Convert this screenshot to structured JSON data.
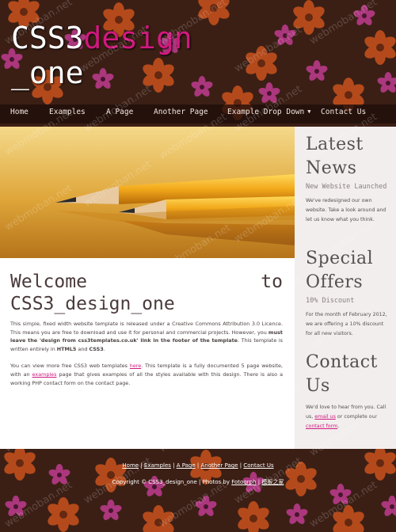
{
  "site": {
    "logo_part1": "CSS3",
    "logo_part2": "design",
    "logo_part3": "_one"
  },
  "nav": {
    "items": [
      {
        "label": "Home"
      },
      {
        "label": "Examples"
      },
      {
        "label": "A Page"
      },
      {
        "label": "Another Page"
      },
      {
        "label": "Example Drop Down",
        "caret": "▼"
      },
      {
        "label": "Contact Us"
      }
    ]
  },
  "main": {
    "heading_line1_a": "Welcome",
    "heading_line1_b": "to",
    "heading_line2": "CSS3_design_one",
    "para1_a": "This simple, fixed width website template is released under a Creative Commons Attribution 3.0 Licence. This means you are free to download and use it for personal and commercial projects. However, you ",
    "para1_bold1": "must leave the 'design from css3templates.co.uk' link in the footer of the template",
    "para1_b": ". This template is written entirely in ",
    "para1_bold2": "HTML5",
    "para1_c": " and ",
    "para1_bold3": "CSS3",
    "para1_d": ".",
    "para2_a": "You can view more free CSS3 web templates ",
    "para2_link1": "here",
    "para2_b": ". This template is a fully documented 5 page website, with an ",
    "para2_link2": "examples",
    "para2_c": " page that gives examples of all the styles available with this design. There is also a working PHP contact form on the contact page."
  },
  "sidebar": {
    "latest": {
      "title": "Latest News",
      "subtitle": "New Website Launched",
      "text": "We've redesigned our own website. Take a look around and let us know what you think."
    },
    "offers": {
      "title": "Special Offers",
      "subtitle": "10% Discount",
      "text": "For the month of February 2012, we are offering a 10% discount for all new visitors."
    },
    "contact": {
      "title": "Contact Us",
      "text_a": "We'd love to hear from you. Call us, ",
      "link1": "email us",
      "text_b": " or complete our ",
      "link2": "contact form",
      "text_c": "."
    }
  },
  "footer": {
    "nav": [
      "Home",
      "Examples",
      "A Page",
      "Another Page",
      "Contact Us"
    ],
    "separator": " | ",
    "copyright_text": "Copyright © CSS3_design_one | Photos by ",
    "photos_link": "Fotogrph",
    "separator2": " | ",
    "design_link": "模板之家"
  },
  "watermark": "webmoban.net"
}
